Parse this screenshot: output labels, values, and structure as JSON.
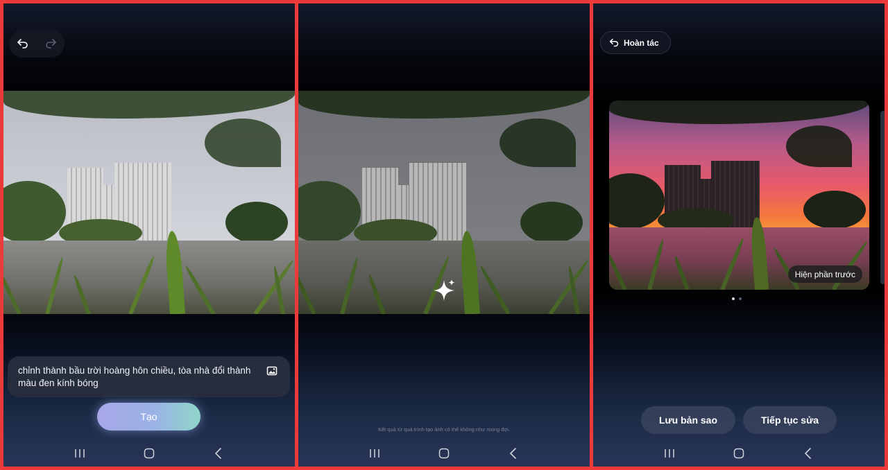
{
  "panel1": {
    "prompt_text": "chỉnh thành bầu trời hoàng hôn chiều, tòa nhà đổi thành màu đen kính bóng",
    "create_label": "Tạo"
  },
  "panel2": {
    "disclaimer": "Kết quả từ quá trình tạo ảnh có thể không như mong đợi."
  },
  "panel3": {
    "undo_label": "Hoàn tác",
    "show_before_label": "Hiện phần trước",
    "save_copy_label": "Lưu bản sao",
    "continue_edit_label": "Tiếp tục sửa",
    "page_dots": {
      "total": 2,
      "active": 1
    }
  },
  "colors": {
    "border": "#ec3a3a",
    "create_gradient_start": "#a8a7e8",
    "create_gradient_end": "#8fd6c8"
  },
  "icons": [
    "undo-icon",
    "redo-icon",
    "image-icon",
    "sparkle-icon",
    "recent-apps-icon",
    "home-icon",
    "back-icon"
  ]
}
